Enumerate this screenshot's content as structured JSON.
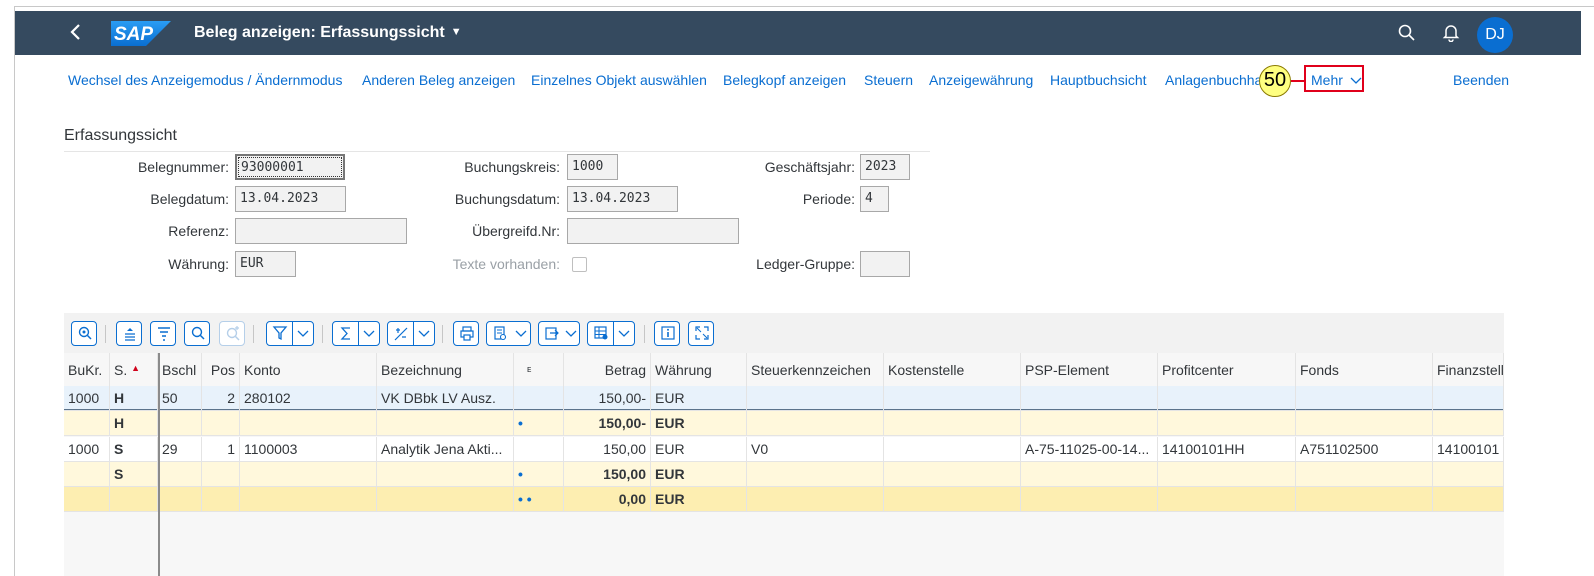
{
  "shell": {
    "title": "Beleg anzeigen: Erfassungssicht",
    "logo_text": "SAP",
    "avatar": "DJ"
  },
  "toolbar": {
    "items": [
      "Wechsel des Anzeigemodus / Ändernmodus",
      "Anderen Beleg anzeigen",
      "Einzelnes Objekt auswählen",
      "Belegkopf anzeigen",
      "Steuern",
      "Anzeigewährung",
      "Hauptbuchsicht",
      "Anlagenbuchha"
    ],
    "more": "Mehr",
    "exit": "Beenden",
    "step_badge": "50"
  },
  "form": {
    "section_title": "Erfassungssicht",
    "belegnummer_label": "Belegnummer:",
    "belegnummer": "93000001",
    "buchungskreis_label": "Buchungskreis:",
    "buchungskreis": "1000",
    "geschaeftsjahr_label": "Geschäftsjahr:",
    "geschaeftsjahr": "2023",
    "belegdatum_label": "Belegdatum:",
    "belegdatum": "13.04.2023",
    "buchungsdatum_label": "Buchungsdatum:",
    "buchungsdatum": "13.04.2023",
    "periode_label": "Periode:",
    "periode": "4",
    "referenz_label": "Referenz:",
    "referenz": "",
    "uebergreifd_label": "Übergreifd.Nr:",
    "uebergreifd": "",
    "waehrung_label": "Währung:",
    "waehrung": "EUR",
    "texte_label": "Texte vorhanden:",
    "ledger_label": "Ledger-Gruppe:",
    "ledger": ""
  },
  "grid": {
    "columns": [
      "BuKr.",
      "S.",
      "Bschl",
      "Pos",
      "Konto",
      "Bezeichnung",
      "ᴇ",
      "Betrag",
      "Währung",
      "Steuerkennzeichen",
      "Kostenstelle",
      "PSP-Element",
      "Profitcenter",
      "Fonds",
      "Finanzstell"
    ],
    "rows": [
      [
        "1000",
        "H",
        "50",
        "2",
        "280102",
        "VK DBbk LV Ausz.",
        "",
        "150,00-",
        "EUR",
        "",
        "",
        "",
        "",
        "",
        ""
      ],
      [
        "",
        "H",
        "",
        "",
        "",
        "",
        "•",
        "150,00-",
        "EUR",
        "",
        "",
        "",
        "",
        "",
        ""
      ],
      [
        "1000",
        "S",
        "29",
        "1",
        "1100003",
        "Analytik Jena Akti...",
        "",
        "150,00",
        "EUR",
        "V0",
        "",
        "A-75-11025-00-14...",
        "14100101HH",
        "A751102500",
        "14100101"
      ],
      [
        "",
        "S",
        "",
        "",
        "",
        "",
        "•",
        "150,00",
        "EUR",
        "",
        "",
        "",
        "",
        "",
        ""
      ],
      [
        "",
        "",
        "",
        "",
        "",
        "",
        "• •",
        "0,00",
        "EUR",
        "",
        "",
        "",
        "",
        "",
        ""
      ]
    ],
    "colors": {
      "selected_row": "#e8f2fb",
      "subtotal_row": "#fff8dc",
      "total_row": "#fdeeb1"
    }
  }
}
